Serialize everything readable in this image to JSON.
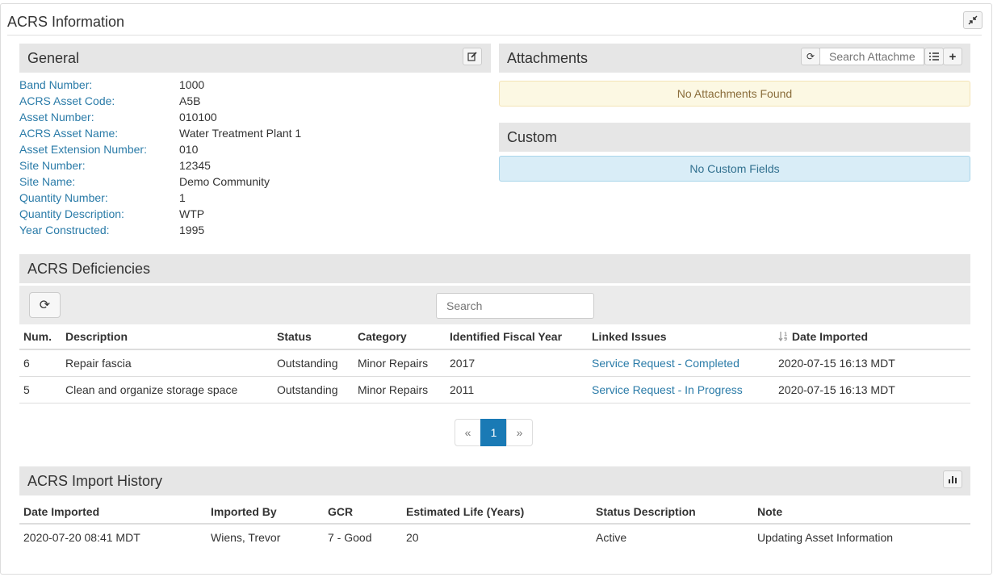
{
  "window": {
    "title": "ACRS Information"
  },
  "general": {
    "title": "General",
    "fields": [
      {
        "label": "Band Number:",
        "value": "1000"
      },
      {
        "label": "ACRS Asset Code:",
        "value": "A5B"
      },
      {
        "label": "Asset Number:",
        "value": "010100"
      },
      {
        "label": "ACRS Asset Name:",
        "value": "Water Treatment Plant 1"
      },
      {
        "label": "Asset Extension Number:",
        "value": "010"
      },
      {
        "label": "Site Number:",
        "value": "12345"
      },
      {
        "label": "Site Name:",
        "value": "Demo Community"
      },
      {
        "label": "Quantity Number:",
        "value": "1"
      },
      {
        "label": "Quantity Description:",
        "value": "WTP"
      },
      {
        "label": "Year Constructed:",
        "value": "1995"
      }
    ]
  },
  "attachments": {
    "title": "Attachments",
    "search_placeholder": "Search Attachme",
    "empty_message": "No Attachments Found"
  },
  "custom": {
    "title": "Custom",
    "empty_message": "No Custom Fields"
  },
  "deficiencies": {
    "title": "ACRS Deficiencies",
    "search_placeholder": "Search",
    "columns": [
      "Num.",
      "Description",
      "Status",
      "Category",
      "Identified Fiscal Year",
      "Linked Issues",
      "Date Imported"
    ],
    "rows": [
      {
        "num": "6",
        "description": "Repair fascia",
        "status": "Outstanding",
        "category": "Minor Repairs",
        "year": "2017",
        "linked": "Service Request - Completed",
        "date": "2020-07-15 16:13 MDT"
      },
      {
        "num": "5",
        "description": "Clean and organize storage space",
        "status": "Outstanding",
        "category": "Minor Repairs",
        "year": "2011",
        "linked": "Service Request - In Progress",
        "date": "2020-07-15 16:13 MDT"
      }
    ],
    "pagination": {
      "prev": "«",
      "current": "1",
      "next": "»"
    }
  },
  "history": {
    "title": "ACRS Import History",
    "columns": [
      "Date Imported",
      "Imported By",
      "GCR",
      "Estimated Life (Years)",
      "Status Description",
      "Note"
    ],
    "rows": [
      {
        "date": "2020-07-20 08:41 MDT",
        "by": "Wiens, Trevor",
        "gcr": "7 - Good",
        "life": "20",
        "status": "Active",
        "note": "Updating Asset Information"
      }
    ]
  },
  "icons": {
    "collapse": "compress-icon",
    "edit": "edit-icon",
    "refresh": "refresh-icon",
    "list": "list-icon",
    "add": "plus-icon",
    "sort": "sort-icon",
    "chart": "bar-chart-icon"
  },
  "colors": {
    "link": "#2a7ba8",
    "panel_header": "#e6e6e6",
    "active_page": "#1a7ab5"
  }
}
